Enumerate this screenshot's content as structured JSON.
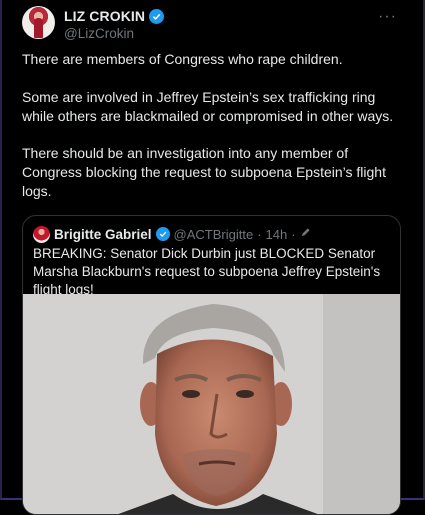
{
  "tweet": {
    "author_name": "LIZ CROKIN",
    "author_handle": "@LizCrokin",
    "more_icon": "more-dots-icon",
    "paragraphs": [
      "There are members of Congress who rape children.",
      "Some are involved in Jeffrey Epstein’s sex trafficking ring while others are blackmailed or compromised in other ways.",
      "There should be an investigation into any member of Congress blocking the request to subpoena Epstein’s flight logs."
    ]
  },
  "quoted": {
    "author_name": "Brigitte Gabriel",
    "author_handle": "@ACTBrigitte",
    "separator": "·",
    "time": "14h",
    "text": "BREAKING: Senator Dick Durbin just BLOCKED Senator Marsha Blackburn's request to subpoena Jeffrey Epstein's flight logs!"
  },
  "colors": {
    "background": "#000000",
    "text": "#e7e9ea",
    "muted": "#71767b",
    "verified": "#1d9bf0",
    "border": "#2f3336"
  }
}
